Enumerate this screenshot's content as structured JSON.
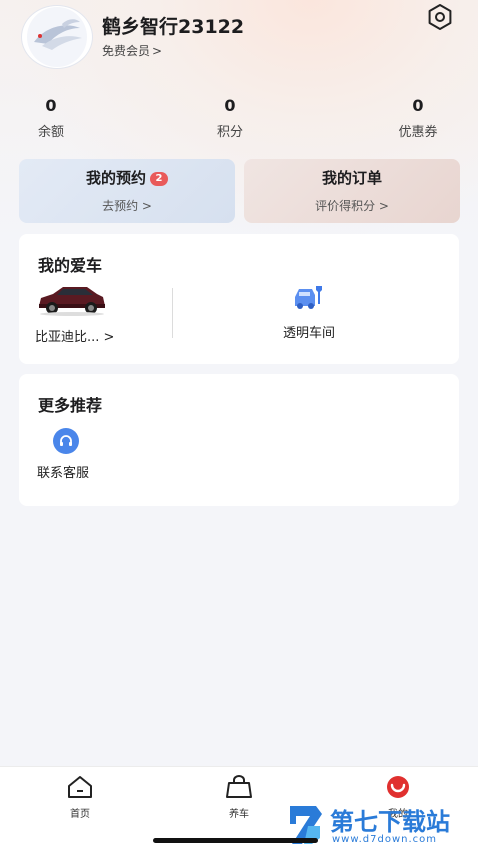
{
  "profile": {
    "username": "鹤乡智行23122",
    "member_label": "免费会员",
    "member_chevron": ">"
  },
  "stats": [
    {
      "value": "0",
      "label": "余额"
    },
    {
      "value": "0",
      "label": "积分"
    },
    {
      "value": "0",
      "label": "优惠券"
    }
  ],
  "cards": {
    "appointment": {
      "title": "我的预约",
      "badge": "2",
      "subtitle": "去预约 >"
    },
    "orders": {
      "title": "我的订单",
      "subtitle": "评价得积分 >"
    }
  },
  "my_car": {
    "title": "我的爱车",
    "car_name": "比亚迪比... >",
    "workshop_label": "透明车间"
  },
  "more": {
    "title": "更多推荐",
    "service_label": "联系客服"
  },
  "tabbar": {
    "items": [
      {
        "label": "首页"
      },
      {
        "label": "养车"
      },
      {
        "label": "我的"
      }
    ]
  },
  "watermark": {
    "name": "第七下载站",
    "url": "www.d7down.com"
  },
  "colors": {
    "accent_red": "#e0302f",
    "badge": "#e95a5a",
    "blue_icon": "#3f79e8"
  }
}
